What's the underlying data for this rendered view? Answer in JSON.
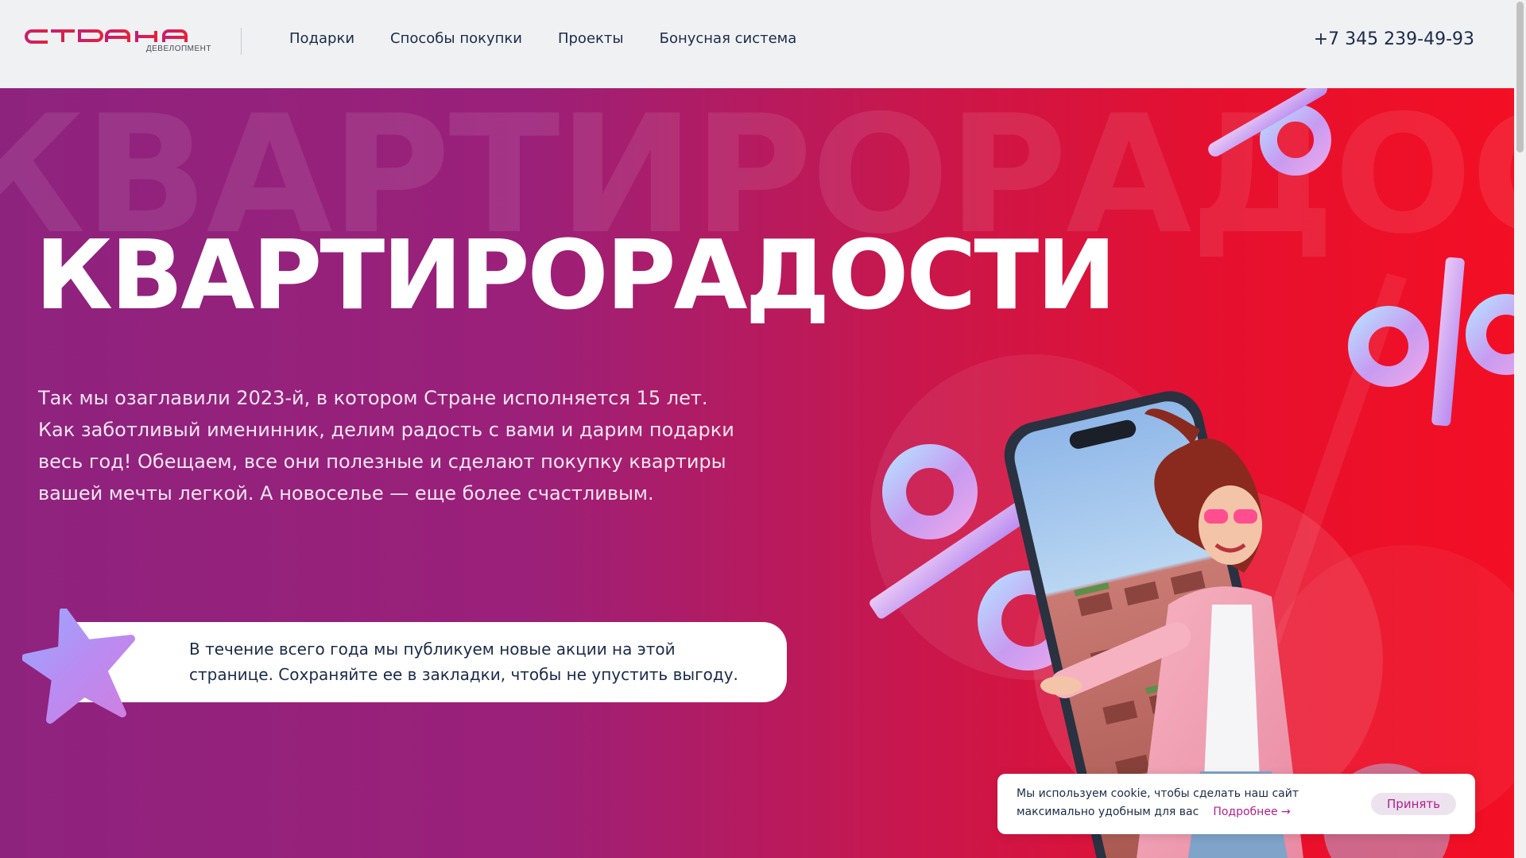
{
  "header": {
    "logo": {
      "word": "СТРАНА",
      "sub": "девелопмент"
    },
    "nav": [
      {
        "label": "Подарки"
      },
      {
        "label": "Способы покупки"
      },
      {
        "label": "Проекты"
      },
      {
        "label": "Бонусная система"
      }
    ],
    "phone": "+7 345 239-49-93"
  },
  "hero": {
    "background_word": "КВАРТИРОРАДОСТИ",
    "title": "КВАРТИРОРАДОСТИ",
    "description": [
      "Так мы озаглавили 2023-й, в котором Стране исполняется 15 лет.",
      "Как заботливый именинник, делим радость с вами и дарим подарки",
      "весь год! Обещаем, все они полезные и сделают покупку квартиры",
      "вашей мечты легкой. А новоселье — еще более счастливым."
    ],
    "notice": [
      "В течение всего года мы публикуем новые акции на этой",
      "странице. Сохраняйте ее в закладки, чтобы не упустить выгоду."
    ]
  },
  "cookie": {
    "line1": "Мы используем cookie, чтобы сделать наш сайт",
    "line2": "максимально удобным для вас",
    "more": "Подробнее →",
    "accept": "Принять"
  },
  "colors": {
    "brand": "#e0245e",
    "text_dark": "#1c2b4a",
    "gradient_left": "#8e237e",
    "gradient_right": "#f30f24"
  }
}
